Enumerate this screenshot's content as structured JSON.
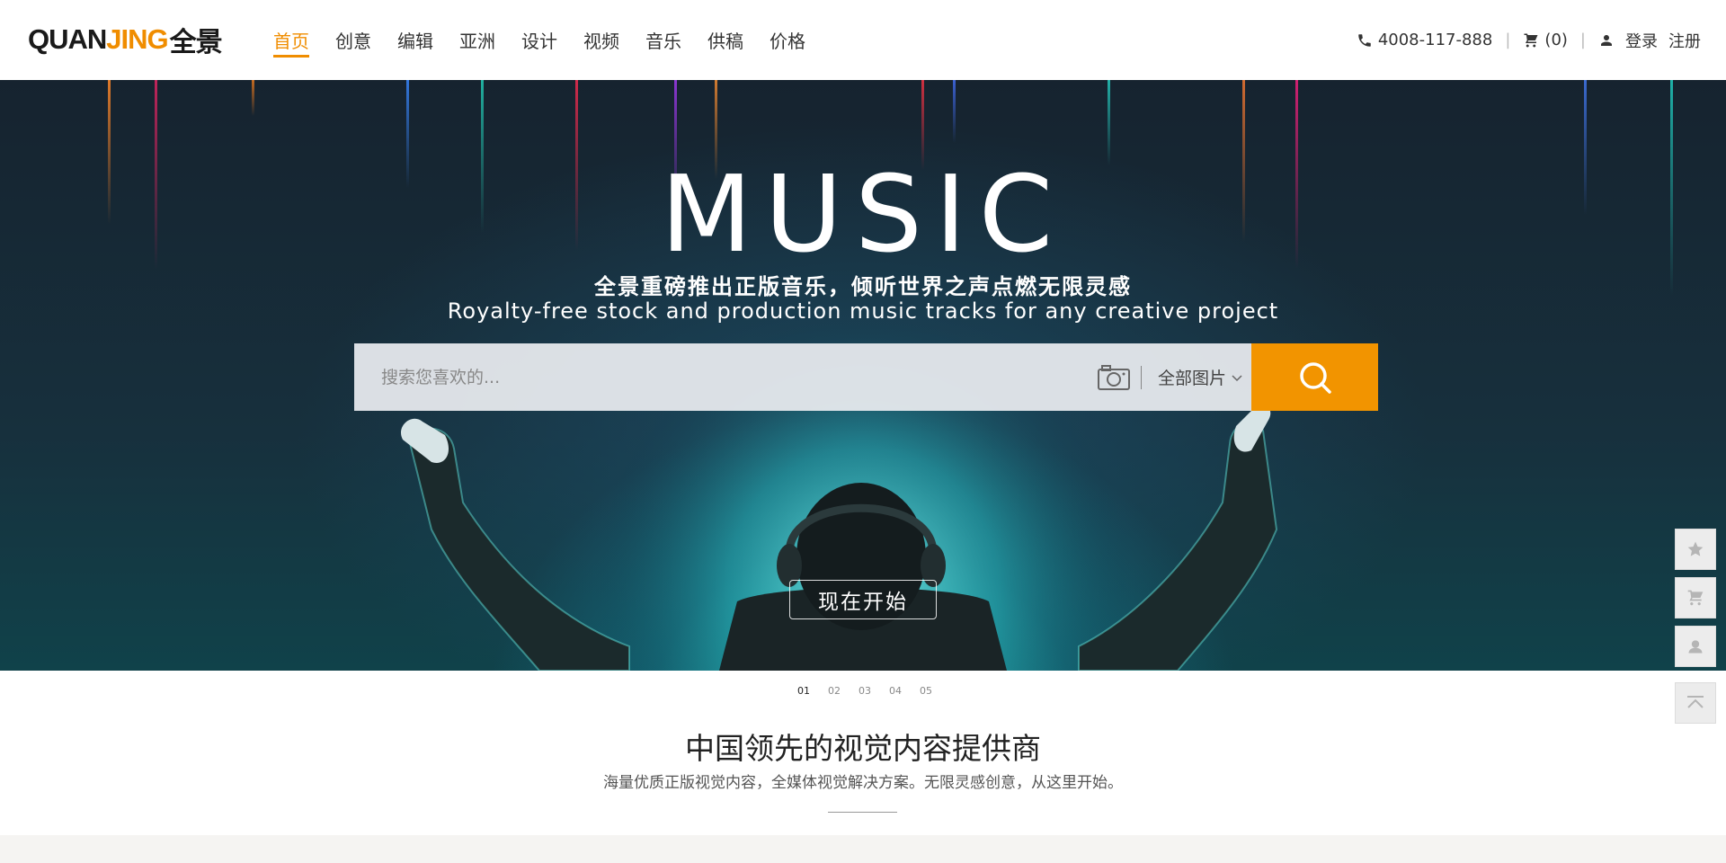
{
  "header": {
    "logo": {
      "part1": "QUAN",
      "part2": "JING",
      "part3": "全景"
    },
    "nav": [
      {
        "label": "首页",
        "active": true
      },
      {
        "label": "创意"
      },
      {
        "label": "编辑"
      },
      {
        "label": "亚洲"
      },
      {
        "label": "设计"
      },
      {
        "label": "视频"
      },
      {
        "label": "音乐"
      },
      {
        "label": "供稿"
      },
      {
        "label": "价格"
      }
    ],
    "phone": "4008-117-888",
    "cart": "(0)",
    "login": "登录",
    "register": "注册"
  },
  "hero": {
    "title": "MUSIC",
    "subtitle_cn": "全景重磅推出正版音乐，倾听世界之声点燃无限灵感",
    "subtitle_en": "Royalty-free stock and production music tracks for any creative project",
    "search_placeholder": "搜索您喜欢的...",
    "scope": "全部图片",
    "start_button": "现在开始"
  },
  "pager": [
    "01",
    "02",
    "03",
    "04",
    "05"
  ],
  "intro": {
    "title": "中国领先的视觉内容提供商",
    "desc": "海量优质正版视觉内容，全媒体视觉解决方案。无限灵感创意，从这里开始。"
  },
  "colors": {
    "accent": "#f08d00",
    "search_button": "#f29400"
  }
}
